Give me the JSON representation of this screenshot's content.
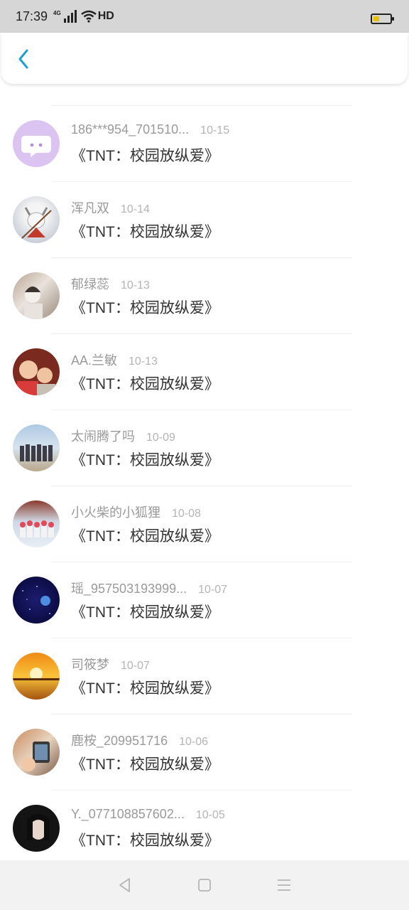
{
  "status": {
    "time": "17:39",
    "network": "4G",
    "hd": "HD",
    "battery_level": 0.35,
    "battery_color": "#e6c100"
  },
  "colors": {
    "accent": "#1e9fd6"
  },
  "items": [
    {
      "name": "186***954_701510...",
      "date": "10-15",
      "title": "《TNT：校园放纵爱》"
    },
    {
      "name": "浑凡双",
      "date": "10-14",
      "title": "《TNT：校园放纵爱》"
    },
    {
      "name": "郁绿蕊",
      "date": "10-13",
      "title": "《TNT：校园放纵爱》"
    },
    {
      "name": "AA.兰敏",
      "date": "10-13",
      "title": "《TNT：校园放纵爱》"
    },
    {
      "name": "太闹腾了吗",
      "date": "10-09",
      "title": "《TNT：校园放纵爱》"
    },
    {
      "name": "小火柴的小狐狸",
      "date": "10-08",
      "title": "《TNT：校园放纵爱》"
    },
    {
      "name": "瑶_957503193999...",
      "date": "10-07",
      "title": "《TNT：校园放纵爱》"
    },
    {
      "name": "司筱梦",
      "date": "10-07",
      "title": "《TNT：校园放纵爱》"
    },
    {
      "name": "鹿桉_209951716",
      "date": "10-06",
      "title": "《TNT：校园放纵爱》"
    },
    {
      "name": "Y._077108857602...",
      "date": "10-05",
      "title": "《TNT：校园放纵爱》"
    }
  ]
}
